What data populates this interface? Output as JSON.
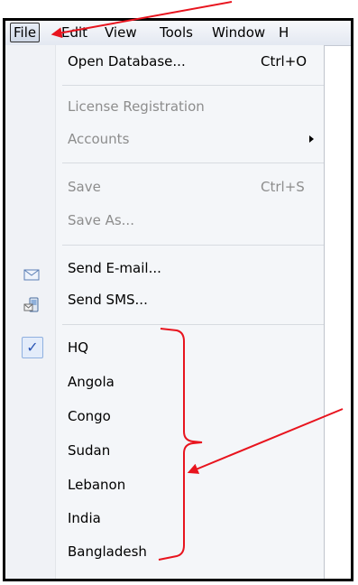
{
  "menubar": {
    "file": "File",
    "edit": "Edit",
    "view": "View",
    "tools": "Tools",
    "window": "Window",
    "help_partial": "H"
  },
  "file_menu": {
    "open_database": {
      "label": "Open Database...",
      "shortcut": "Ctrl+O"
    },
    "license_registration": {
      "label": "License Registration"
    },
    "accounts": {
      "label": "Accounts"
    },
    "save": {
      "label": "Save",
      "shortcut": "Ctrl+S"
    },
    "save_as": {
      "label": "Save As..."
    },
    "send_email": {
      "label": "Send E-mail..."
    },
    "send_sms": {
      "label": "Send SMS..."
    },
    "databases": [
      {
        "label": "HQ",
        "checked": true
      },
      {
        "label": "Angola",
        "checked": false
      },
      {
        "label": "Congo",
        "checked": false
      },
      {
        "label": "Sudan",
        "checked": false
      },
      {
        "label": "Lebanon",
        "checked": false
      },
      {
        "label": "India",
        "checked": false
      },
      {
        "label": "Bangladesh",
        "checked": false
      }
    ],
    "check_mark": "✓"
  },
  "annotations": {
    "color": "#e8141e"
  }
}
